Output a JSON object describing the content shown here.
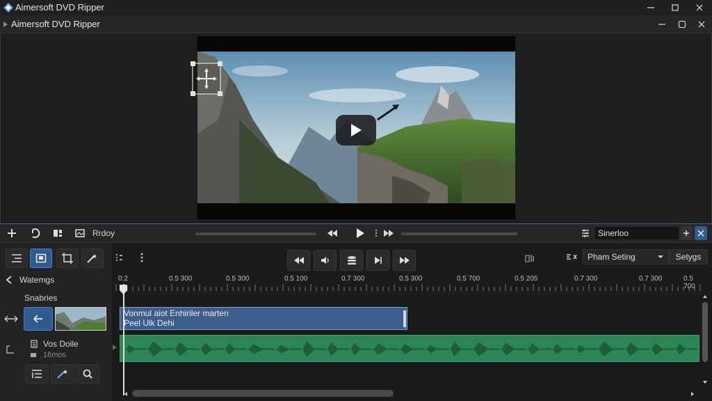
{
  "window": {
    "title": "Aimersoft DVD Ripper",
    "app_title": "Aimersoft DVD Ripper"
  },
  "player": {
    "ready_label": "Rrdoy",
    "search_value": "Sinerloo"
  },
  "controls": {
    "preset_label": "Pham Seting",
    "settings_label": "Setygs"
  },
  "left_panel": {
    "section_label": "Watemgs",
    "subsection_label": "Snabries",
    "media": {
      "title": "Vos Doile",
      "subtitle": "16mos"
    }
  },
  "timeline": {
    "ticks": [
      "0:2",
      "0.5 300",
      "0.5 300",
      "0.5 100",
      "0.7 300",
      "0.5 300",
      "0.5 700",
      "0.5 205",
      "0.7 300",
      "0.7 300",
      "0.5 700"
    ],
    "clip_text_line1": "Vonmul aiot Enhiriler marten",
    "clip_text_line2": "Peel Ulk Dehi"
  },
  "colors": {
    "accent": "#2f5b8f",
    "clip": "#3d5e8c",
    "audio": "#2d8555",
    "background": "#1e1e1e"
  }
}
